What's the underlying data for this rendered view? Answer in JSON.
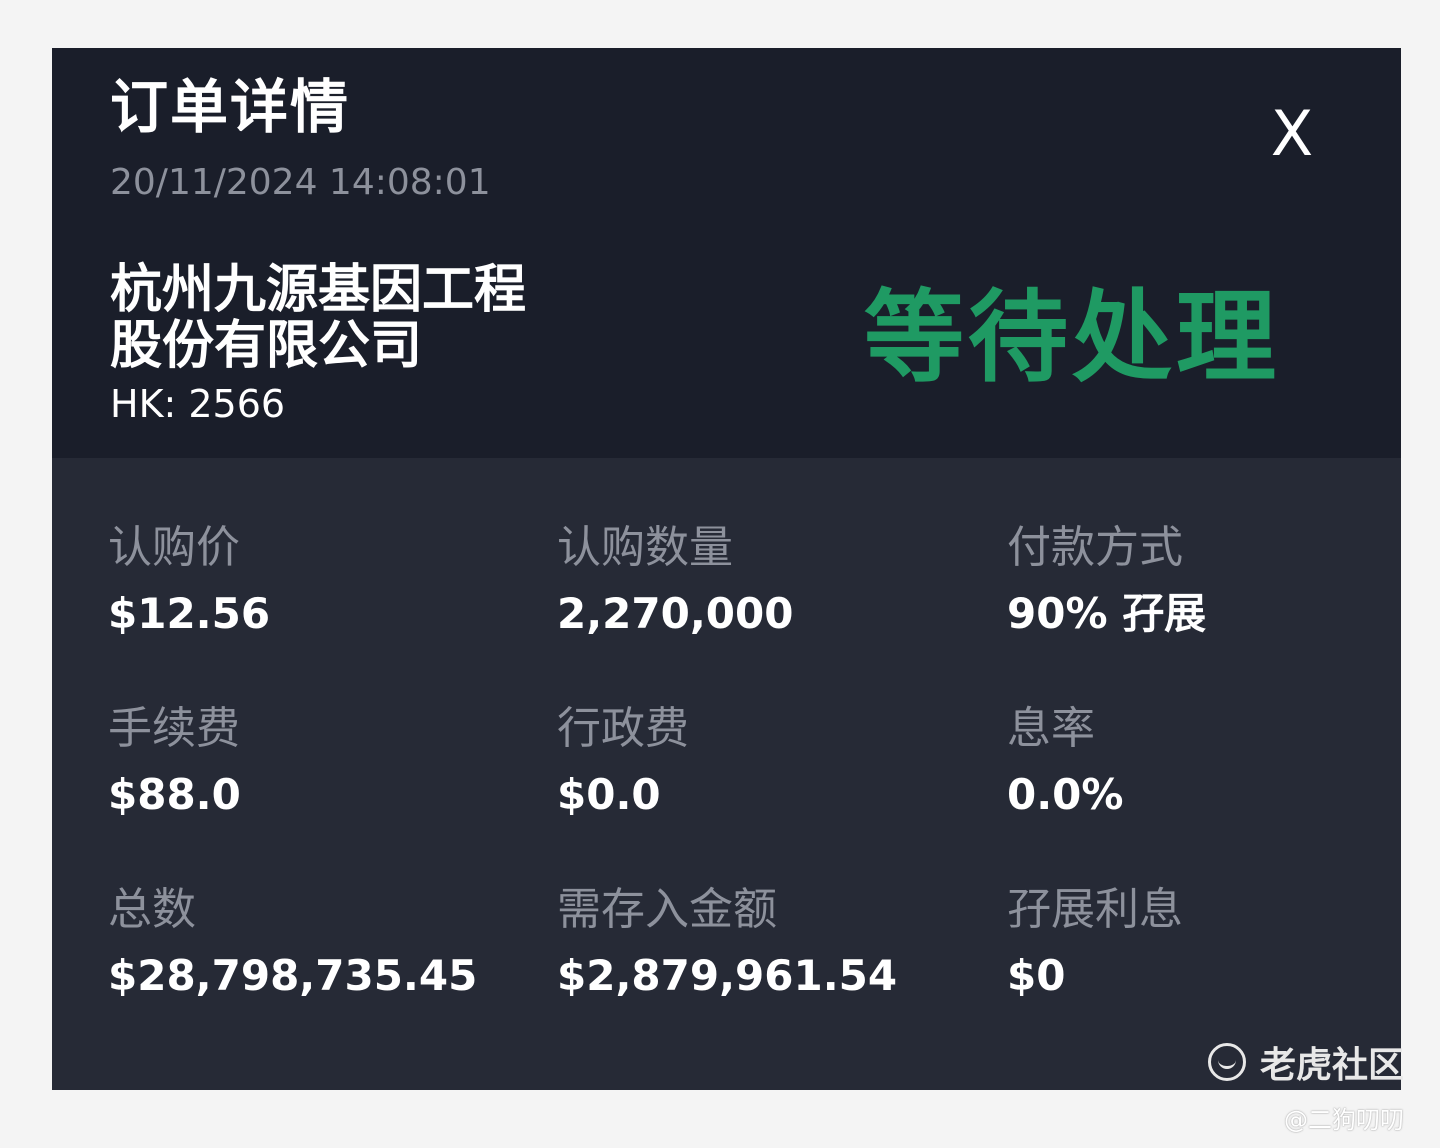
{
  "header": {
    "title": "订单详情",
    "timestamp": "20/11/2024 14:08:01",
    "close_label": "X"
  },
  "stock": {
    "name_line1": "杭州九源基因工程",
    "name_line2": "股份有限公司",
    "ticker": "HK: 2566"
  },
  "status": {
    "text": "等待处理",
    "color": "#1f9a63"
  },
  "details": [
    {
      "label": "认购价",
      "value": "$12.56"
    },
    {
      "label": "认购数量",
      "value": "2,270,000"
    },
    {
      "label": "付款方式",
      "value": "90% 孖展"
    },
    {
      "label": "手续费",
      "value": "$88.0"
    },
    {
      "label": "行政费",
      "value": "$0.0"
    },
    {
      "label": "息率",
      "value": "0.0%"
    },
    {
      "label": "总数",
      "value": "$28,798,735.45"
    },
    {
      "label": "需存入金额",
      "value": "$2,879,961.54"
    },
    {
      "label": "孖展利息",
      "value": "$0"
    }
  ],
  "watermark": {
    "icon": "tiger-logo-icon",
    "text": "老虎社区",
    "credit": "@二狗叨叨"
  }
}
